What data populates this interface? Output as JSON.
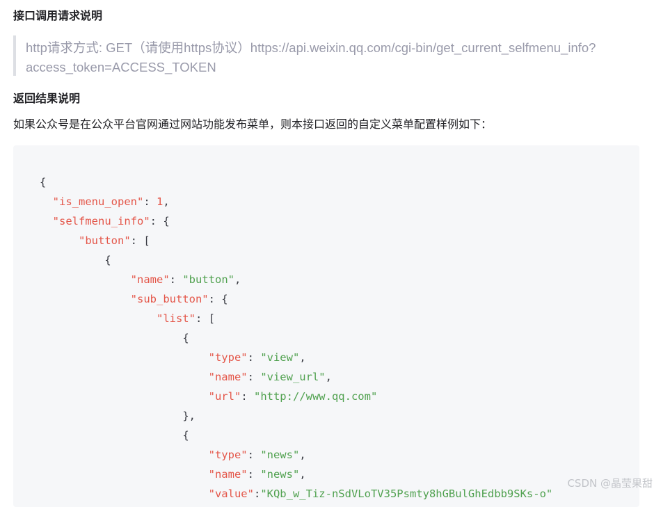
{
  "section_request": {
    "title": "接口调用请求说明",
    "quote_lines": [
      "http请求方式: GET（请使用https协议）https://api.weixin.qq.com/cgi-bin/get_current_selfmenu_info?",
      "access_token=ACCESS_TOKEN"
    ]
  },
  "section_result": {
    "title": "返回结果说明",
    "description": "如果公众号是在公众平台官网通过网站功能发布菜单，则本接口返回的自定义菜单配置样例如下："
  },
  "code_lines": [
    {
      "indent": "",
      "tokens": [
        {
          "t": "p",
          "v": "{"
        }
      ]
    },
    {
      "indent": "  ",
      "tokens": [
        {
          "t": "k",
          "v": "\"is_menu_open\""
        },
        {
          "t": "p",
          "v": ": "
        },
        {
          "t": "k",
          "v": "1"
        },
        {
          "t": "p",
          "v": ","
        }
      ]
    },
    {
      "indent": "  ",
      "tokens": [
        {
          "t": "k",
          "v": "\"selfmenu_info\""
        },
        {
          "t": "p",
          "v": ": {"
        }
      ]
    },
    {
      "indent": "      ",
      "tokens": [
        {
          "t": "k",
          "v": "\"button\""
        },
        {
          "t": "p",
          "v": ": ["
        }
      ]
    },
    {
      "indent": "          ",
      "tokens": [
        {
          "t": "p",
          "v": "{"
        }
      ]
    },
    {
      "indent": "              ",
      "tokens": [
        {
          "t": "k",
          "v": "\"name\""
        },
        {
          "t": "p",
          "v": ": "
        },
        {
          "t": "s",
          "v": "\"button\""
        },
        {
          "t": "p",
          "v": ","
        }
      ]
    },
    {
      "indent": "              ",
      "tokens": [
        {
          "t": "k",
          "v": "\"sub_button\""
        },
        {
          "t": "p",
          "v": ": {"
        }
      ]
    },
    {
      "indent": "                  ",
      "tokens": [
        {
          "t": "k",
          "v": "\"list\""
        },
        {
          "t": "p",
          "v": ": ["
        }
      ]
    },
    {
      "indent": "                      ",
      "tokens": [
        {
          "t": "p",
          "v": "{"
        }
      ]
    },
    {
      "indent": "                          ",
      "tokens": [
        {
          "t": "k",
          "v": "\"type\""
        },
        {
          "t": "p",
          "v": ": "
        },
        {
          "t": "s",
          "v": "\"view\""
        },
        {
          "t": "p",
          "v": ","
        }
      ]
    },
    {
      "indent": "                          ",
      "tokens": [
        {
          "t": "k",
          "v": "\"name\""
        },
        {
          "t": "p",
          "v": ": "
        },
        {
          "t": "s",
          "v": "\"view_url\""
        },
        {
          "t": "p",
          "v": ","
        }
      ]
    },
    {
      "indent": "                          ",
      "tokens": [
        {
          "t": "k",
          "v": "\"url\""
        },
        {
          "t": "p",
          "v": ": "
        },
        {
          "t": "s",
          "v": "\"http://www.qq.com\""
        }
      ]
    },
    {
      "indent": "                      ",
      "tokens": [
        {
          "t": "p",
          "v": "},"
        }
      ]
    },
    {
      "indent": "                      ",
      "tokens": [
        {
          "t": "p",
          "v": "{"
        }
      ]
    },
    {
      "indent": "                          ",
      "tokens": [
        {
          "t": "k",
          "v": "\"type\""
        },
        {
          "t": "p",
          "v": ": "
        },
        {
          "t": "s",
          "v": "\"news\""
        },
        {
          "t": "p",
          "v": ","
        }
      ]
    },
    {
      "indent": "                          ",
      "tokens": [
        {
          "t": "k",
          "v": "\"name\""
        },
        {
          "t": "p",
          "v": ": "
        },
        {
          "t": "s",
          "v": "\"news\""
        },
        {
          "t": "p",
          "v": ","
        }
      ]
    },
    {
      "indent": "                          ",
      "tokens": [
        {
          "t": "k",
          "v": "\"value\""
        },
        {
          "t": "p",
          "v": ":"
        },
        {
          "t": "s",
          "v": "\"KQb_w_Tiz-nSdVLoTV35Psmty8hGBulGhEdbb9SKs-o\""
        }
      ]
    }
  ],
  "watermark": "CSDN @晶莹果甜",
  "colors": {
    "key": "#e45649",
    "string": "#50a14f",
    "punctuation": "#383a42",
    "code_background": "#f6f7f9",
    "quote_border": "#dddfe4"
  }
}
